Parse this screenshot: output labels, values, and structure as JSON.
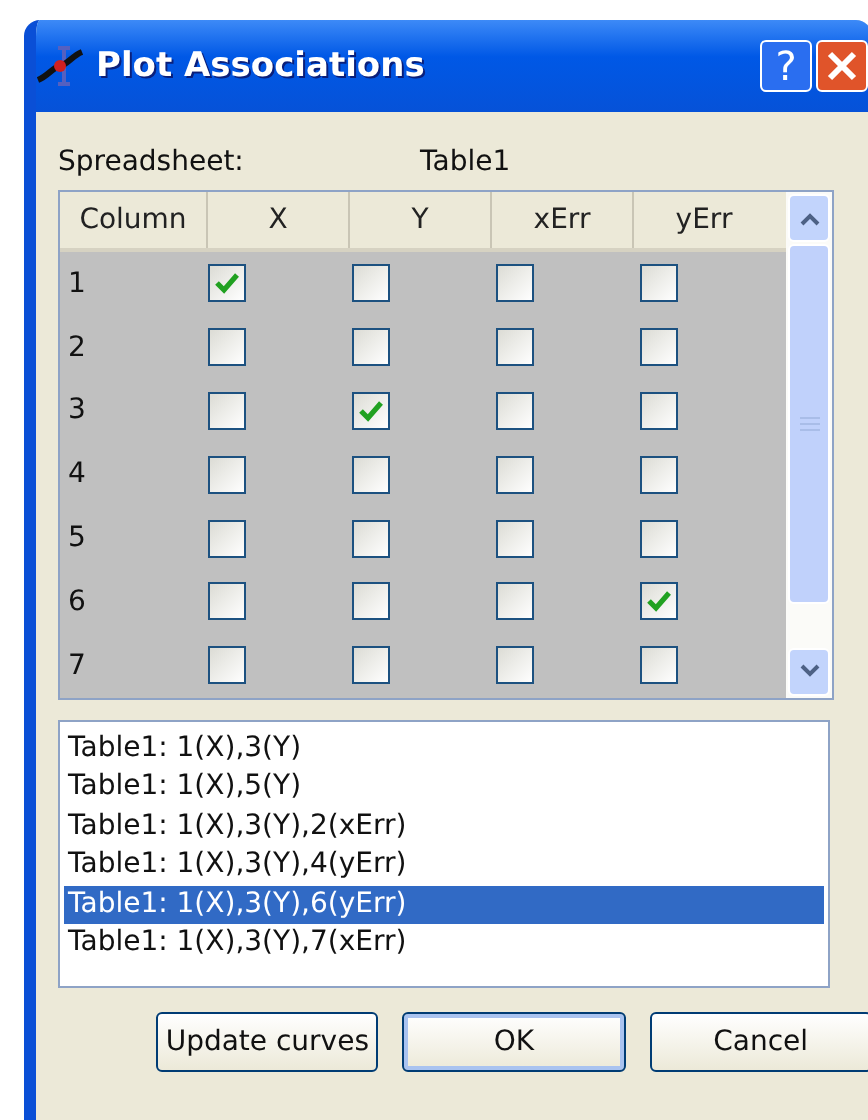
{
  "window": {
    "title": "Plot Associations"
  },
  "spreadsheet": {
    "label": "Spreadsheet:",
    "value": "Table1"
  },
  "table": {
    "columns": [
      "Column",
      "X",
      "Y",
      "xErr",
      "yErr"
    ],
    "rows": [
      {
        "label": "1",
        "checks": [
          true,
          false,
          false,
          false
        ]
      },
      {
        "label": "2",
        "checks": [
          false,
          false,
          false,
          false
        ]
      },
      {
        "label": "3",
        "checks": [
          false,
          true,
          false,
          false
        ]
      },
      {
        "label": "4",
        "checks": [
          false,
          false,
          false,
          false
        ]
      },
      {
        "label": "5",
        "checks": [
          false,
          false,
          false,
          false
        ]
      },
      {
        "label": "6",
        "checks": [
          false,
          false,
          false,
          true
        ]
      },
      {
        "label": "7",
        "checks": [
          false,
          false,
          false,
          false
        ]
      }
    ]
  },
  "curves": [
    {
      "label": "Table1: 1(X),3(Y)",
      "selected": false
    },
    {
      "label": "Table1: 1(X),5(Y)",
      "selected": false
    },
    {
      "label": "Table1: 1(X),3(Y),2(xErr)",
      "selected": false
    },
    {
      "label": "Table1: 1(X),3(Y),4(yErr)",
      "selected": false
    },
    {
      "label": "Table1: 1(X),3(Y),6(yErr)",
      "selected": true
    },
    {
      "label": "Table1: 1(X),3(Y),7(xErr)",
      "selected": false
    }
  ],
  "buttons": [
    {
      "label": "Update curves",
      "default": false
    },
    {
      "label": "OK",
      "default": true
    },
    {
      "label": "Cancel",
      "default": false
    }
  ],
  "title_buttons": [
    "?"
  ]
}
